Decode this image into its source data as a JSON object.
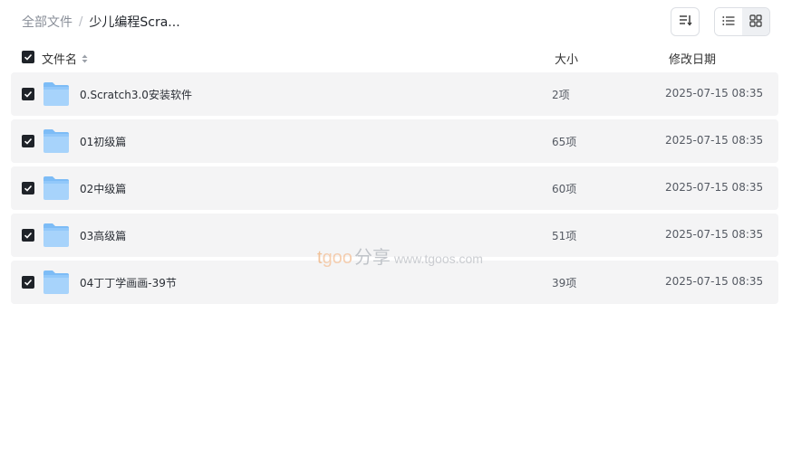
{
  "breadcrumb": {
    "root": "全部文件",
    "separator": "/",
    "current": "少儿编程Scra..."
  },
  "toolbar": {
    "sort_icon": "sort-icon",
    "list_view_icon": "list-view-icon",
    "grid_view_icon": "grid-view-icon"
  },
  "table": {
    "columns": {
      "name": "文件名",
      "size": "大小",
      "date": "修改日期"
    },
    "rows": [
      {
        "name": "0.Scratch3.0安装软件",
        "size": "2项",
        "date": "2025-07-15 08:35"
      },
      {
        "name": "01初级篇",
        "size": "65项",
        "date": "2025-07-15 08:35"
      },
      {
        "name": "02中级篇",
        "size": "60项",
        "date": "2025-07-15 08:35"
      },
      {
        "name": "03高级篇",
        "size": "51项",
        "date": "2025-07-15 08:35"
      },
      {
        "name": "04丁丁学画画-39节",
        "size": "39项",
        "date": "2025-07-15 08:35"
      }
    ]
  },
  "watermark": {
    "t": "t",
    "goo": "goo",
    "share": "分享",
    "url": "www.tgoos.com"
  },
  "colors": {
    "row_bg": "#f4f4f5",
    "checkbox": "#1f2329",
    "folder_light": "#a7d3fb",
    "folder_dark": "#7dbcf6"
  }
}
